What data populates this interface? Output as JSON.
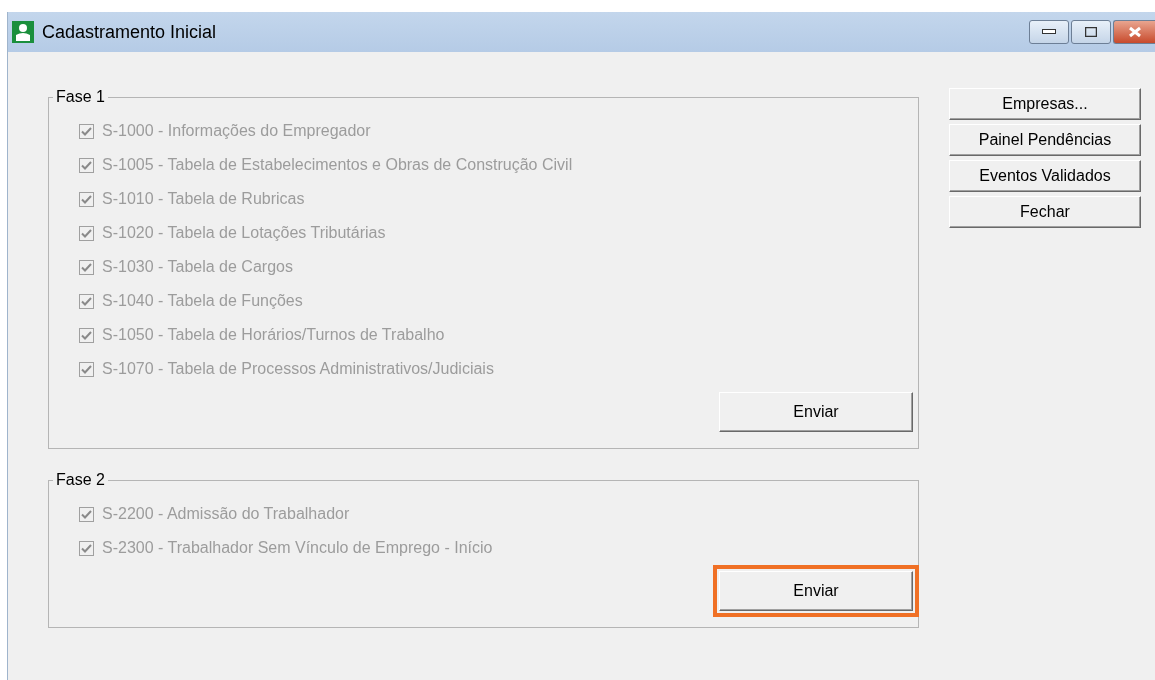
{
  "window": {
    "title": "Cadastramento Inicial"
  },
  "groups": [
    {
      "title": "Fase 1",
      "items": [
        {
          "label": "S-1000 - Informações do Empregador",
          "checked": true,
          "disabled": true
        },
        {
          "label": "S-1005 - Tabela de Estabelecimentos e Obras de Construção Civil",
          "checked": true,
          "disabled": true
        },
        {
          "label": "S-1010 - Tabela de Rubricas",
          "checked": true,
          "disabled": true
        },
        {
          "label": "S-1020 - Tabela de Lotações Tributárias",
          "checked": true,
          "disabled": true
        },
        {
          "label": "S-1030 - Tabela de Cargos",
          "checked": true,
          "disabled": true
        },
        {
          "label": "S-1040 - Tabela de Funções",
          "checked": true,
          "disabled": true
        },
        {
          "label": "S-1050 - Tabela de Horários/Turnos de Trabalho",
          "checked": true,
          "disabled": true
        },
        {
          "label": "S-1070 - Tabela de Processos Administrativos/Judiciais",
          "checked": true,
          "disabled": true
        }
      ],
      "button": {
        "label": "Enviar",
        "highlighted": false
      }
    },
    {
      "title": "Fase 2",
      "items": [
        {
          "label": "S-2200 - Admissão do Trabalhador",
          "checked": true,
          "disabled": true
        },
        {
          "label": "S-2300 - Trabalhador Sem Vínculo de Emprego - Início",
          "checked": true,
          "disabled": true
        }
      ],
      "button": {
        "label": "Enviar",
        "highlighted": true
      }
    }
  ],
  "side_buttons": [
    "Empresas...",
    "Painel Pendências",
    "Eventos Validados",
    "Fechar"
  ]
}
